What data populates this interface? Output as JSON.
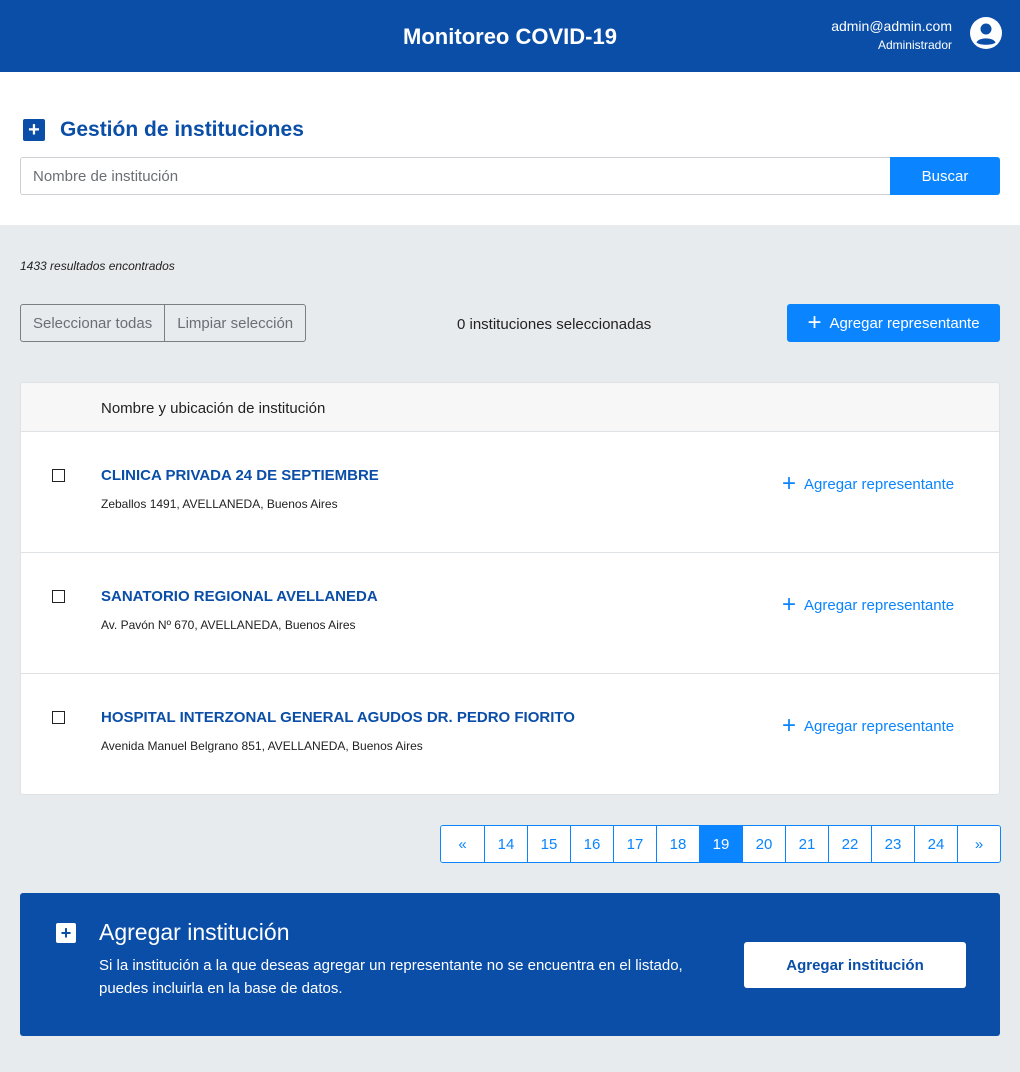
{
  "header": {
    "title": "Monitoreo COVID-19",
    "user_email": "admin@admin.com",
    "user_role": "Administrador",
    "avatar_icon": "user-circle-icon"
  },
  "page": {
    "title": "Gestión de instituciones",
    "title_icon": "plus-square-icon",
    "search_placeholder": "Nombre de institución",
    "search_button": "Buscar"
  },
  "results": {
    "count_text": "1433 resultados encontrados",
    "select_all": "Seleccionar todas",
    "clear_selection": "Limpiar selección",
    "selected_text": "0 instituciones seleccionadas",
    "add_representative": "Agregar representante"
  },
  "table": {
    "header": "Nombre y ubicación de institución",
    "rows": [
      {
        "name": "CLINICA PRIVADA 24 DE SEPTIEMBRE",
        "address": "Zeballos 1491, AVELLANEDA, Buenos Aires",
        "action": "Agregar representante",
        "checked": false
      },
      {
        "name": "SANATORIO REGIONAL AVELLANEDA",
        "address": "Av. Pavón Nº 670, AVELLANEDA, Buenos Aires",
        "action": "Agregar representante",
        "checked": false
      },
      {
        "name": "HOSPITAL INTERZONAL GENERAL AGUDOS DR. PEDRO FIORITO",
        "address": "Avenida Manuel Belgrano 851, AVELLANEDA, Buenos Aires",
        "action": "Agregar representante",
        "checked": false
      }
    ]
  },
  "pagination": {
    "prev": "«",
    "next": "»",
    "pages": [
      "14",
      "15",
      "16",
      "17",
      "18",
      "19",
      "20",
      "21",
      "22",
      "23",
      "24"
    ],
    "current": "19"
  },
  "cta": {
    "title": "Agregar institución",
    "text": "Si la institución a la que deseas agregar un representante no se encuentra en el listado, puedes incluirla en la base de datos.",
    "button": "Agregar institución"
  },
  "colors": {
    "brand_dark": "#0a4ea8",
    "brand_accent": "#0a84ff",
    "background": "#e8ebee"
  }
}
